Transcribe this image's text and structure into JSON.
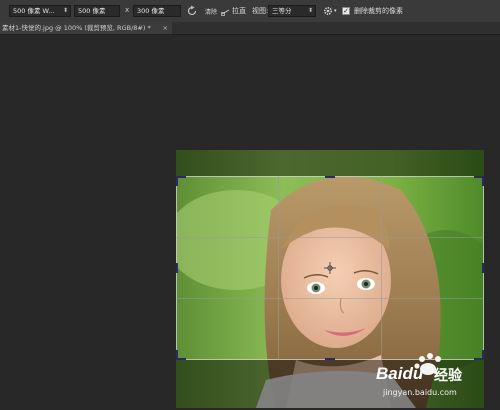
{
  "toolbar": {
    "ratio_select": "500 像素 W...",
    "width_value": "500 像素",
    "times": "x",
    "height_value": "300 像素",
    "clear_label": "清除",
    "straighten_label": "拉直",
    "view_label": "视图:",
    "view_select": "三等分",
    "delete_cropped_label": "删除裁剪的像素",
    "delete_cropped_checked": true
  },
  "tab": {
    "title": "素材1-快觉的.jpg @ 100% (裁剪预览, RGB/8#) *",
    "close_symbol": "×"
  },
  "watermark": {
    "brand": "Baidu",
    "brand_cn": "经验",
    "url": "jingyan.baidu.com"
  }
}
